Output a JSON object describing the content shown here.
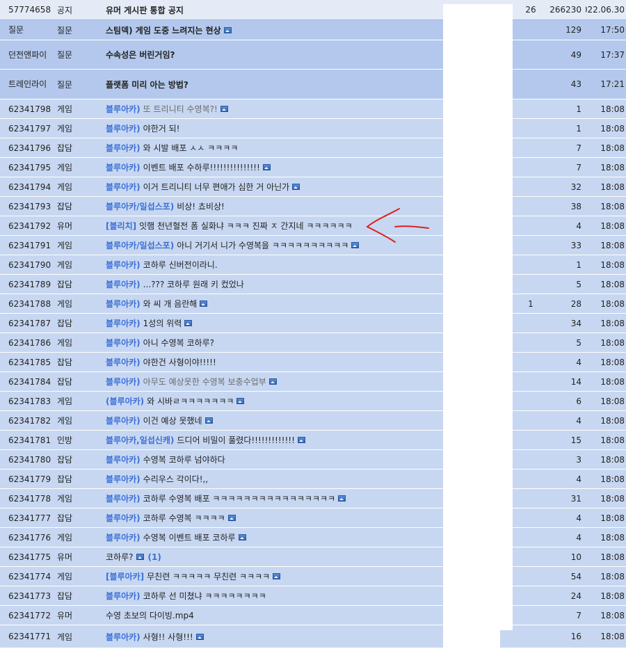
{
  "columns": [
    "num",
    "category",
    "title",
    "replies",
    "views",
    "time"
  ],
  "colors": {
    "accent_tag": "#3b6fd6",
    "row_bg": "#c7d7f1",
    "question_bg": "#b3c8ec",
    "annotation": "#e0201c"
  },
  "rows": [
    {
      "num": "57774658",
      "cat": "공지",
      "tag": "",
      "title": "유머 게시판 통합 공지",
      "img": false,
      "cmt": "",
      "replies": "26",
      "views": "266230",
      "time": "2022.06.30",
      "type": "notice",
      "muted": false
    },
    {
      "num": "질문",
      "cat": "질문",
      "tag": "",
      "title": "스팀덱) 게임 도중 느려지는 현상",
      "img": true,
      "cmt": "",
      "replies": "",
      "views": "129",
      "time": "17:50",
      "type": "question",
      "muted": false
    },
    {
      "num": "던전앤파이",
      "cat": "질문",
      "tag": "",
      "title": "수속성은 버린거임?",
      "img": false,
      "cmt": "",
      "replies": "",
      "views": "49",
      "time": "17:37",
      "type": "question",
      "muted": false
    },
    {
      "num": "트레인라이",
      "cat": "질문",
      "tag": "",
      "title": "플랫폼 미리 아는 방법?",
      "img": false,
      "cmt": "",
      "replies": "",
      "views": "43",
      "time": "17:21",
      "type": "question",
      "muted": false
    },
    {
      "num": "62341798",
      "cat": "게임",
      "tag": "블루아카)",
      "title": "또 트리니티 수영복?!",
      "img": true,
      "cmt": "",
      "replies": "",
      "views": "1",
      "time": "18:08",
      "type": "normal",
      "muted": true
    },
    {
      "num": "62341797",
      "cat": "게임",
      "tag": "블루아카)",
      "title": "야한거 되!",
      "img": false,
      "cmt": "",
      "replies": "",
      "views": "1",
      "time": "18:08",
      "type": "normal",
      "muted": false
    },
    {
      "num": "62341796",
      "cat": "잡담",
      "tag": "블루아카)",
      "title": "와 시발 배포 ㅅㅅ ㅋㅋㅋㅋ",
      "img": false,
      "cmt": "",
      "replies": "",
      "views": "7",
      "time": "18:08",
      "type": "normal",
      "muted": false
    },
    {
      "num": "62341795",
      "cat": "게임",
      "tag": "블루아카)",
      "title": "이벤트 배포 수하루!!!!!!!!!!!!!!!",
      "img": true,
      "cmt": "",
      "replies": "",
      "views": "7",
      "time": "18:08",
      "type": "normal",
      "muted": false
    },
    {
      "num": "62341794",
      "cat": "게임",
      "tag": "블루아카)",
      "title": "이거 트리니티 너무 편애가 심한 거 아닌가",
      "img": true,
      "cmt": "",
      "replies": "",
      "views": "32",
      "time": "18:08",
      "type": "normal",
      "muted": false
    },
    {
      "num": "62341793",
      "cat": "잡담",
      "tag": "블루아카/일섭스포)",
      "title": "비상! 쵸비상!",
      "img": false,
      "cmt": "",
      "replies": "",
      "views": "38",
      "time": "18:08",
      "type": "normal",
      "muted": false
    },
    {
      "num": "62341792",
      "cat": "유머",
      "tag": "[블리치]",
      "title": "잇햄 천년혈전 폼 실화냐 ㅋㅋㅋ 진짜 ㅈ 간지네 ㅋㅋㅋㅋㅋㅋ",
      "img": false,
      "cmt": "",
      "replies": "",
      "views": "4",
      "time": "18:08",
      "type": "normal",
      "muted": false
    },
    {
      "num": "62341791",
      "cat": "게임",
      "tag": "블루아카/일섭스포)",
      "title": "아니 거기서 니가 수영복을 ㅋㅋㅋㅋㅋㅋㅋㅋㅋㅋ",
      "img": true,
      "cmt": "",
      "replies": "",
      "views": "33",
      "time": "18:08",
      "type": "normal",
      "muted": false
    },
    {
      "num": "62341790",
      "cat": "게임",
      "tag": "블루아카)",
      "title": "코하루 신버전이라니.",
      "img": false,
      "cmt": "",
      "replies": "",
      "views": "1",
      "time": "18:08",
      "type": "normal",
      "muted": false
    },
    {
      "num": "62341789",
      "cat": "잡담",
      "tag": "블루아카)",
      "title": "...??? 코하루 원래 키 컸었나",
      "img": false,
      "cmt": "",
      "replies": "",
      "views": "5",
      "time": "18:08",
      "type": "normal",
      "muted": false
    },
    {
      "num": "62341788",
      "cat": "게임",
      "tag": "블루아카)",
      "title": "와 씨 개 음란해",
      "img": true,
      "cmt": "",
      "replies": "1",
      "views": "28",
      "time": "18:08",
      "type": "normal",
      "muted": false
    },
    {
      "num": "62341787",
      "cat": "잡담",
      "tag": "블루아카)",
      "title": "1성의 위력",
      "img": true,
      "cmt": "",
      "replies": "",
      "views": "34",
      "time": "18:08",
      "type": "normal",
      "muted": false
    },
    {
      "num": "62341786",
      "cat": "게임",
      "tag": "블루아카)",
      "title": "아니 수영복 코하루?",
      "img": false,
      "cmt": "",
      "replies": "",
      "views": "5",
      "time": "18:08",
      "type": "normal",
      "muted": false
    },
    {
      "num": "62341785",
      "cat": "잡담",
      "tag": "블루아카)",
      "title": "야한건 사형이야!!!!!",
      "img": false,
      "cmt": "",
      "replies": "",
      "views": "4",
      "time": "18:08",
      "type": "normal",
      "muted": false
    },
    {
      "num": "62341784",
      "cat": "잡담",
      "tag": "블루아카)",
      "title": "아무도 예상못한 수영복 보충수업부",
      "img": true,
      "cmt": "",
      "replies": "",
      "views": "14",
      "time": "18:08",
      "type": "normal",
      "muted": true
    },
    {
      "num": "62341783",
      "cat": "게임",
      "tag": "(블루아카)",
      "title": "와 시바ㄹㅋㅋㅋㅋㅋㅋㅋ",
      "img": true,
      "cmt": "",
      "replies": "",
      "views": "6",
      "time": "18:08",
      "type": "normal",
      "muted": false
    },
    {
      "num": "62341782",
      "cat": "게임",
      "tag": "블루아카)",
      "title": "이건 예상 못했네",
      "img": true,
      "cmt": "",
      "replies": "",
      "views": "4",
      "time": "18:08",
      "type": "normal",
      "muted": false
    },
    {
      "num": "62341781",
      "cat": "인방",
      "tag": "블루아카,일섭신캐)",
      "title": "드디어 비밀이 풀렸다!!!!!!!!!!!!!",
      "img": true,
      "cmt": "",
      "replies": "",
      "views": "15",
      "time": "18:08",
      "type": "normal",
      "muted": false
    },
    {
      "num": "62341780",
      "cat": "잡담",
      "tag": "블루아카)",
      "title": "수영복 코하루 넘야하다",
      "img": false,
      "cmt": "",
      "replies": "",
      "views": "3",
      "time": "18:08",
      "type": "normal",
      "muted": false
    },
    {
      "num": "62341779",
      "cat": "잡담",
      "tag": "블루아카)",
      "title": "수리우스 각이다!,,",
      "img": false,
      "cmt": "",
      "replies": "",
      "views": "4",
      "time": "18:08",
      "type": "normal",
      "muted": false
    },
    {
      "num": "62341778",
      "cat": "게임",
      "tag": "블루아카)",
      "title": "코하루 수영복 배포 ㅋㅋㅋㅋㅋㅋㅋㅋㅋㅋㅋㅋㅋㅋㅋㅋ",
      "img": true,
      "cmt": "",
      "replies": "",
      "views": "31",
      "time": "18:08",
      "type": "normal",
      "muted": false
    },
    {
      "num": "62341777",
      "cat": "잡담",
      "tag": "블루아카)",
      "title": "코하루 수영복 ㅋㅋㅋㅋ",
      "img": true,
      "cmt": "",
      "replies": "",
      "views": "4",
      "time": "18:08",
      "type": "normal",
      "muted": false
    },
    {
      "num": "62341776",
      "cat": "게임",
      "tag": "블루아카)",
      "title": "수영복 이벤트 배포 코하루",
      "img": true,
      "cmt": "",
      "replies": "",
      "views": "4",
      "time": "18:08",
      "type": "normal",
      "muted": false
    },
    {
      "num": "62341775",
      "cat": "유머",
      "tag": "",
      "title": "코하루?",
      "img": true,
      "cmt": "(1)",
      "replies": "",
      "views": "10",
      "time": "18:08",
      "type": "normal",
      "muted": false
    },
    {
      "num": "62341774",
      "cat": "게임",
      "tag": "[블루아카]",
      "title": "무친련 ㅋㅋㅋㅋㅋ 무친련 ㅋㅋㅋㅋ",
      "img": true,
      "cmt": "",
      "replies": "",
      "views": "54",
      "time": "18:08",
      "type": "normal",
      "muted": false
    },
    {
      "num": "62341773",
      "cat": "잡담",
      "tag": "블루아카)",
      "title": "코하루 선 미쳤냐 ㅋㅋㅋㅋㅋㅋㅋㅋ",
      "img": false,
      "cmt": "",
      "replies": "",
      "views": "24",
      "time": "18:08",
      "type": "normal",
      "muted": false
    },
    {
      "num": "62341772",
      "cat": "유머",
      "tag": "",
      "title": "수영 초보의 다이빙.mp4",
      "img": false,
      "cmt": "",
      "replies": "",
      "views": "7",
      "time": "18:08",
      "type": "normal",
      "muted": false
    },
    {
      "num": "62341771",
      "cat": "게임",
      "tag": "블루아카)",
      "title": "사형!! 사형!!!",
      "img": true,
      "cmt": "",
      "replies": "",
      "views": "16",
      "time": "18:08",
      "type": "normal",
      "muted": false
    }
  ]
}
